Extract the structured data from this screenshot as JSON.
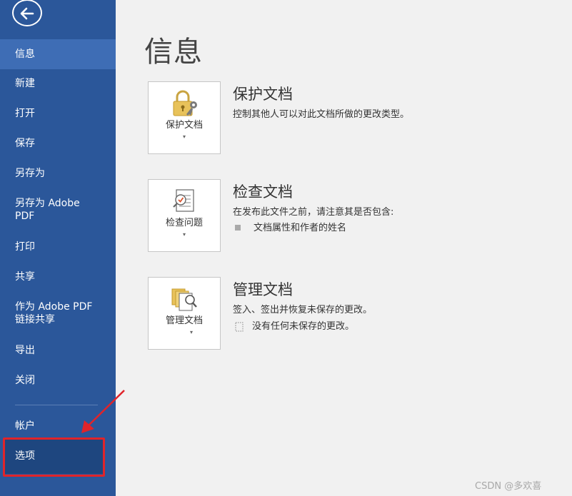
{
  "sidebar": {
    "items": [
      {
        "label": "信息"
      },
      {
        "label": "新建"
      },
      {
        "label": "打开"
      },
      {
        "label": "保存"
      },
      {
        "label": "另存为"
      },
      {
        "label": "另存为 Adobe PDF"
      },
      {
        "label": "打印"
      },
      {
        "label": "共享"
      },
      {
        "label": "作为 Adobe PDF 链接共享"
      },
      {
        "label": "导出"
      },
      {
        "label": "关闭"
      },
      {
        "label": "帐户"
      },
      {
        "label": "选项"
      }
    ]
  },
  "main": {
    "title": "信息",
    "sections": [
      {
        "button_label": "保护文档",
        "title": "保护文档",
        "description": "控制其他人可以对此文档所做的更改类型。",
        "bullets": []
      },
      {
        "button_label": "检查问题",
        "title": "检查文档",
        "description": "在发布此文件之前，请注意其是否包含:",
        "bullets": [
          "文档属性和作者的姓名"
        ]
      },
      {
        "button_label": "管理文档",
        "title": "管理文档",
        "description": "签入、签出并恢复未保存的更改。",
        "bullets": [
          "没有任何未保存的更改。"
        ]
      }
    ]
  },
  "watermark": "CSDN @多欢喜",
  "colors": {
    "sidebar": "#2b579a",
    "sidebar_active": "#3e6db5",
    "annotation_red": "#e0242a"
  }
}
